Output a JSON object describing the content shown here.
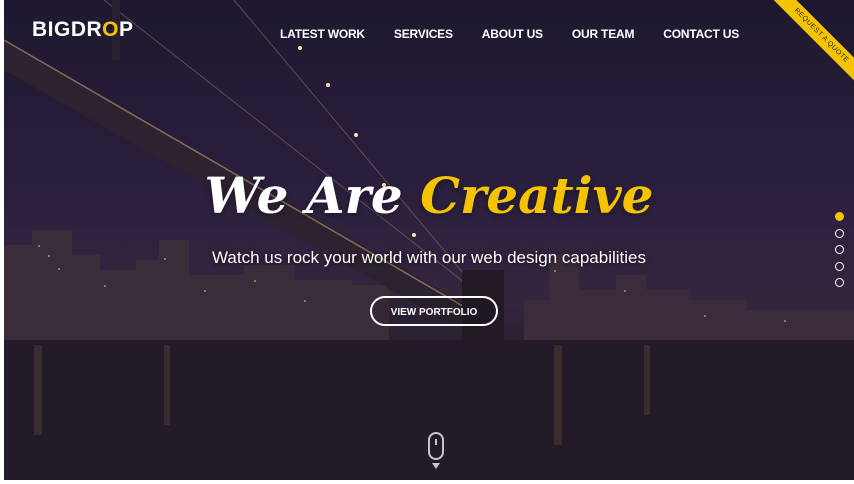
{
  "brand": {
    "logo_text_before": "BIGDR",
    "logo_o": "O",
    "logo_text_after": "P",
    "accent_color": "#f5c400"
  },
  "nav": {
    "items": [
      {
        "label": "LATEST WORK"
      },
      {
        "label": "SERVICES"
      },
      {
        "label": "ABOUT US"
      },
      {
        "label": "OUR TEAM"
      },
      {
        "label": "CONTACT US"
      }
    ]
  },
  "ribbon": {
    "label": "REQUEST A QUOTE"
  },
  "hero": {
    "headline_part1": "We Are",
    "headline_part2": "Creative",
    "subtitle": "Watch us rock your world with our web design capabilities",
    "cta_label": "VIEW PORTFOLIO"
  },
  "slider": {
    "count": 5,
    "active_index": 0
  },
  "scroll_indicator": {
    "icon": "mouse-scroll-icon"
  }
}
